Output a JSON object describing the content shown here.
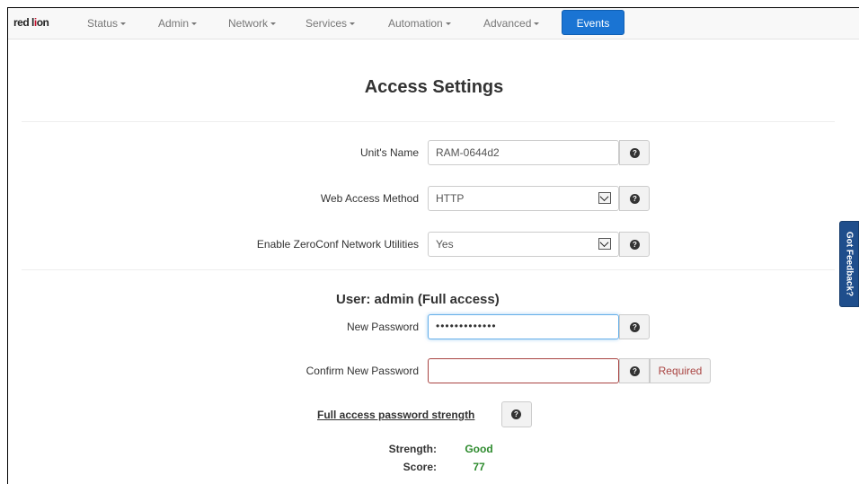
{
  "brand": {
    "name_left": "red l",
    "name_mark": "i",
    "name_right": "on"
  },
  "nav": {
    "items": [
      {
        "label": "Status"
      },
      {
        "label": "Admin"
      },
      {
        "label": "Network"
      },
      {
        "label": "Services"
      },
      {
        "label": "Automation"
      },
      {
        "label": "Advanced"
      }
    ],
    "events_label": "Events"
  },
  "page": {
    "title": "Access Settings"
  },
  "form": {
    "unit_name": {
      "label": "Unit's Name",
      "value": "RAM-0644d2"
    },
    "web_access": {
      "label": "Web Access Method",
      "value": "HTTP"
    },
    "zeroconf": {
      "label": "Enable ZeroConf Network Utilities",
      "value": "Yes"
    }
  },
  "user": {
    "heading": "User: admin (Full access)",
    "new_password": {
      "label": "New Password",
      "value": "•••••••••••••"
    },
    "confirm_password": {
      "label": "Confirm New Password",
      "value": "",
      "validation": "Required"
    }
  },
  "strength": {
    "link": "Full access password strength",
    "strength_label": "Strength:",
    "strength_value": "Good",
    "score_label": "Score:",
    "score_value": "77"
  },
  "help_glyph": "?",
  "feedback_tab": "Got Feedback?",
  "colors": {
    "accent": "#1a74d3",
    "good": "#2e8b2e",
    "error": "#a94442",
    "feedback": "#1f4e8c"
  }
}
